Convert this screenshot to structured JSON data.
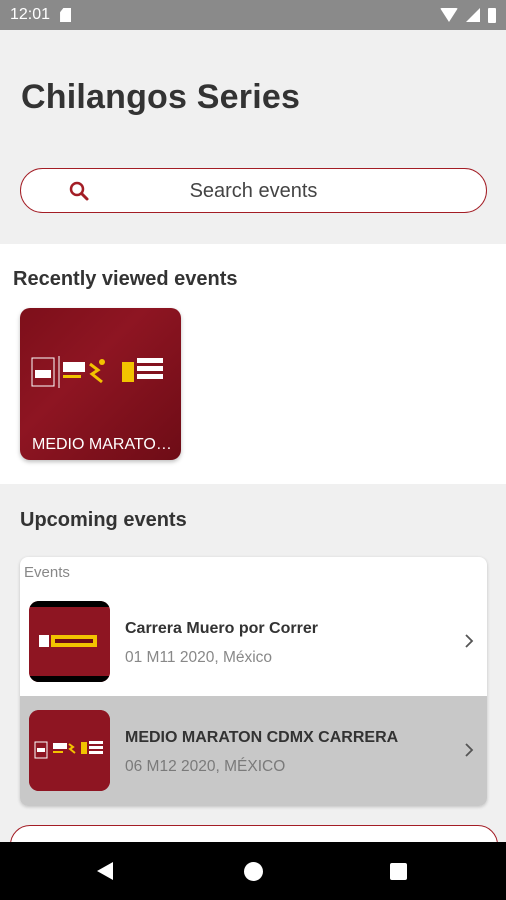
{
  "status_bar": {
    "time": "12:01",
    "icons": [
      "sd-card-icon",
      "wifi-icon",
      "cell-signal-icon",
      "battery-icon"
    ]
  },
  "app": {
    "title": "Chilangos Series",
    "accent_color": "#a31d25"
  },
  "search": {
    "placeholder": "Search events"
  },
  "recent": {
    "title": "Recently viewed events",
    "items": [
      {
        "label": "MEDIO MARATON CDMX CARRERA"
      }
    ]
  },
  "upcoming": {
    "title": "Upcoming events",
    "list_header": "Events",
    "items": [
      {
        "name": "Carrera Muero por Correr",
        "meta": "01 M11 2020, México"
      },
      {
        "name": "MEDIO MARATON CDMX CARRERA",
        "meta": "06 M12 2020, MÉXICO"
      }
    ]
  },
  "nav": {
    "icons": [
      "back-icon",
      "home-icon",
      "recents-icon"
    ]
  }
}
